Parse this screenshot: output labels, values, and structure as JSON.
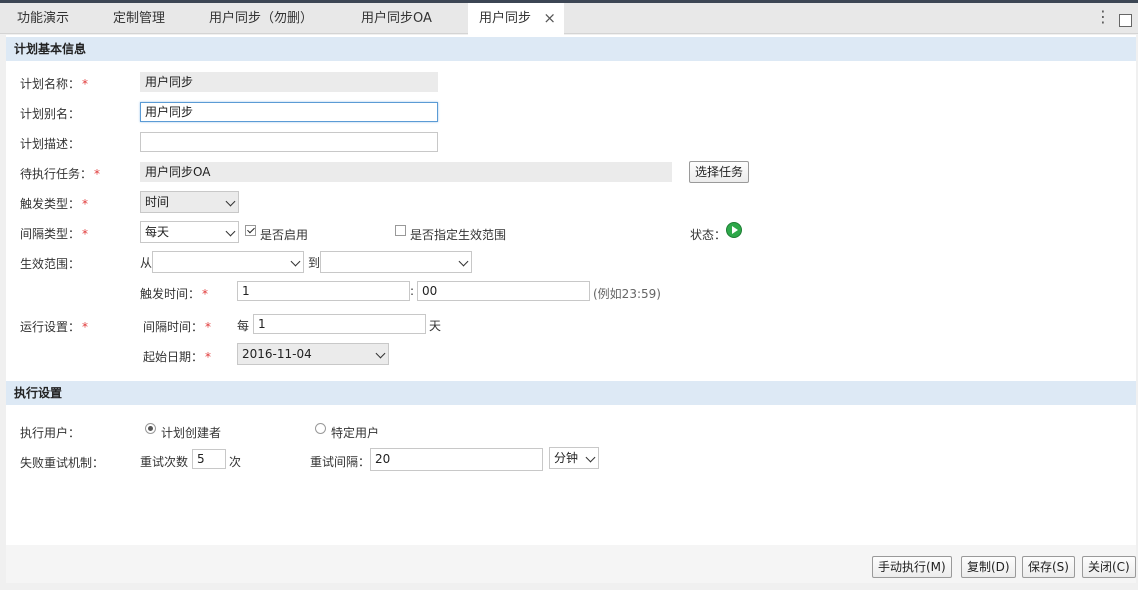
{
  "tabs": [
    {
      "label": "功能演示"
    },
    {
      "label": "定制管理"
    },
    {
      "label": "用户同步（勿删）"
    },
    {
      "label": "用户同步OA"
    },
    {
      "label": "用户同步",
      "active": true
    }
  ],
  "tab_close_icon": "×",
  "menu_icon": "⋮",
  "sections": {
    "basic": "计划基本信息",
    "exec": "执行设置"
  },
  "form": {
    "plan_name_label": "计划名称：",
    "plan_name_value": "用户同步",
    "plan_alias_label": "计划别名：",
    "plan_alias_value": "用户同步",
    "plan_desc_label": "计划描述：",
    "plan_desc_value": "",
    "pending_task_label": "待执行任务：",
    "pending_task_value": "用户同步OA",
    "select_task_button": "选择任务",
    "trigger_type_label": "触发类型：",
    "trigger_type_value": "时间",
    "interval_type_label": "间隔类型：",
    "interval_type_value": "每天",
    "enabled_label": "是否启用",
    "enabled_checked": true,
    "specify_range_label": "是否指定生效范围",
    "specify_range_checked": false,
    "status_label": "状态：",
    "effective_range_label": "生效范围：",
    "range_from": "从",
    "range_to": "到",
    "trigger_time_label": "触发时间：",
    "trigger_hour": "1",
    "time_separator": ":",
    "trigger_minute": "00",
    "trigger_hint": "(例如23:59)",
    "run_settings_label": "运行设置：",
    "interval_time_label": "间隔时间：",
    "every": "每",
    "interval_value": "1",
    "interval_unit": "天",
    "start_date_label": "起始日期：",
    "start_date_value": "2016-11-04",
    "required_mark": "*"
  },
  "exec": {
    "exec_user_label": "执行用户：",
    "creator_label": "计划创建者",
    "creator_checked": true,
    "specific_user_label": "特定用户",
    "specific_user_checked": false,
    "retry_label": "失败重试机制：",
    "retry_count_label": "重试次数",
    "retry_count_value": "5",
    "retry_count_unit": "次",
    "retry_interval_label": "重试间隔：",
    "retry_interval_value": "20",
    "retry_interval_unit": "分钟"
  },
  "footer": {
    "manual_run": "手动执行(M)",
    "copy": "复制(D)",
    "save": "保存(S)",
    "close": "关闭(C)"
  }
}
